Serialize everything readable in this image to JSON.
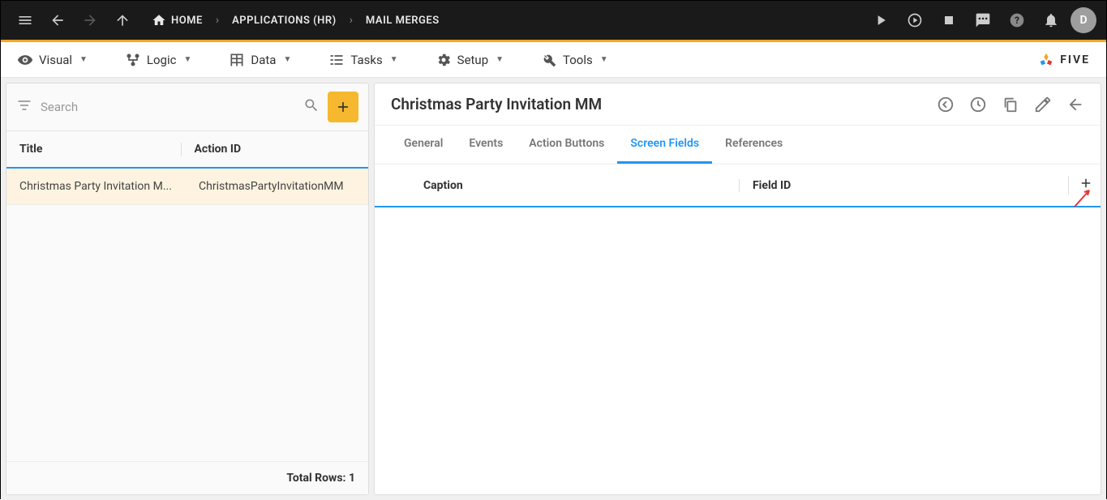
{
  "topbar": {
    "breadcrumb": [
      {
        "label": "HOME",
        "hasHomeIcon": true
      },
      {
        "label": "APPLICATIONS (HR)"
      },
      {
        "label": "MAIL MERGES"
      }
    ],
    "avatar_initial": "D"
  },
  "toolbar": {
    "items": [
      {
        "label": "Visual",
        "icon": "eye"
      },
      {
        "label": "Logic",
        "icon": "diagram"
      },
      {
        "label": "Data",
        "icon": "table"
      },
      {
        "label": "Tasks",
        "icon": "list"
      },
      {
        "label": "Setup",
        "icon": "gear"
      },
      {
        "label": "Tools",
        "icon": "wrench"
      }
    ],
    "logo_text": "FIVE"
  },
  "left": {
    "search_placeholder": "Search",
    "columns": {
      "title": "Title",
      "action_id": "Action ID"
    },
    "rows": [
      {
        "title": "Christmas Party Invitation M...",
        "action_id": "ChristmasPartyInvitationMM"
      }
    ],
    "footer_label": "Total Rows:",
    "footer_count": "1"
  },
  "detail": {
    "title": "Christmas Party Invitation MM",
    "tabs": [
      {
        "label": "General",
        "active": false
      },
      {
        "label": "Events",
        "active": false
      },
      {
        "label": "Action Buttons",
        "active": false
      },
      {
        "label": "Screen Fields",
        "active": true
      },
      {
        "label": "References",
        "active": false
      }
    ],
    "sub_columns": {
      "caption": "Caption",
      "field_id": "Field ID"
    }
  }
}
